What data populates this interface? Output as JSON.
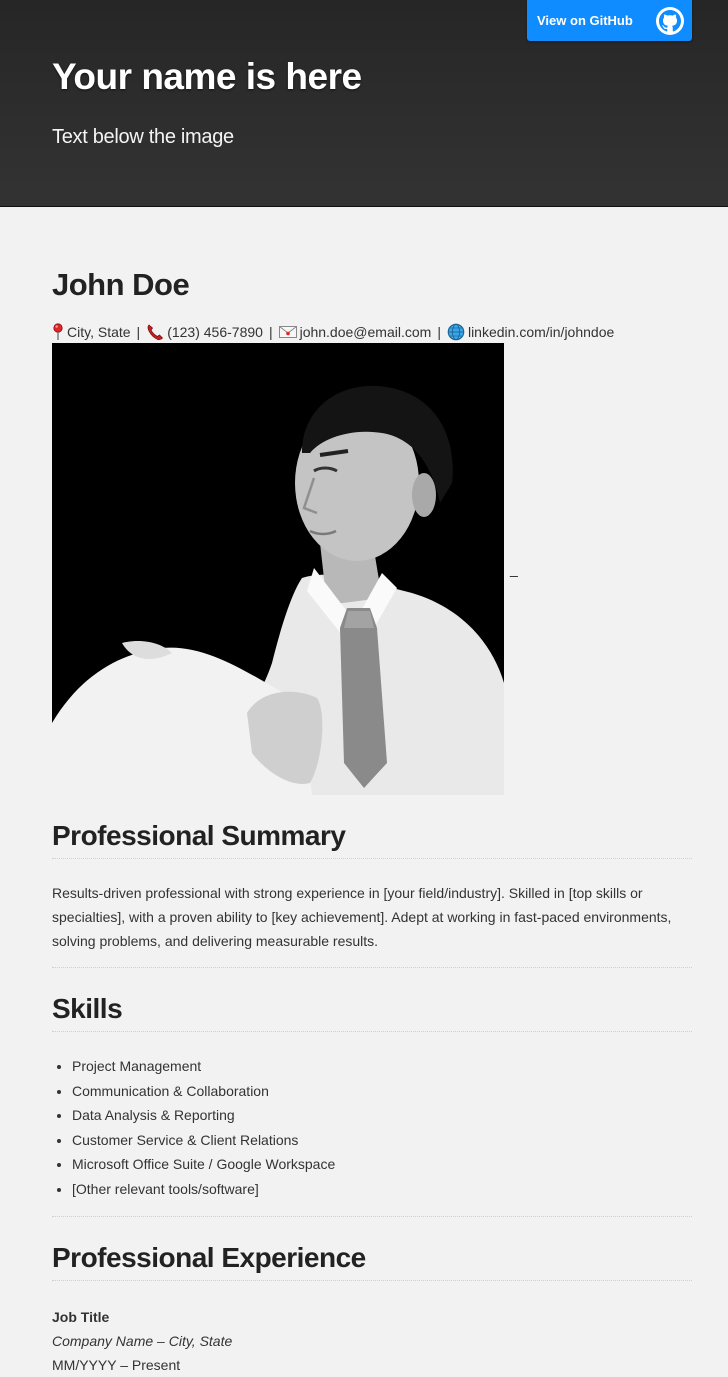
{
  "header": {
    "github_button_label": "View on GitHub",
    "title": "Your name is here",
    "tagline": "Text below the image"
  },
  "resume": {
    "name": "John Doe",
    "contact": {
      "location": "City, State",
      "phone": "(123) 456-7890",
      "email": "john.doe@email.com",
      "linkedin": "linkedin.com/in/johndoe",
      "separator": "|"
    },
    "photo_caption_dash": "_",
    "summary": {
      "heading": "Professional Summary",
      "text": "Results-driven professional with strong experience in [your field/industry]. Skilled in [top skills or specialties], with a proven ability to [key achievement]. Adept at working in fast-paced environments, solving problems, and delivering measurable results."
    },
    "skills": {
      "heading": "Skills",
      "items": [
        "Project Management",
        "Communication & Collaboration",
        "Data Analysis & Reporting",
        "Customer Service & Client Relations",
        "Microsoft Office Suite / Google Workspace",
        "[Other relevant tools/software]"
      ]
    },
    "experience": {
      "heading": "Professional Experience",
      "job_title": "Job Title",
      "company": "Company Name – City, State",
      "dates": "MM/YYYY – Present"
    }
  },
  "colors": {
    "header_bg": "#2d2d2d",
    "github_button": "#0f8cff",
    "page_bg": "#f2f2f2"
  },
  "icons": {
    "location": "pin-icon",
    "phone": "phone-icon",
    "email": "envelope-icon",
    "linkedin": "globe-icon",
    "github": "github-octocat-icon"
  }
}
